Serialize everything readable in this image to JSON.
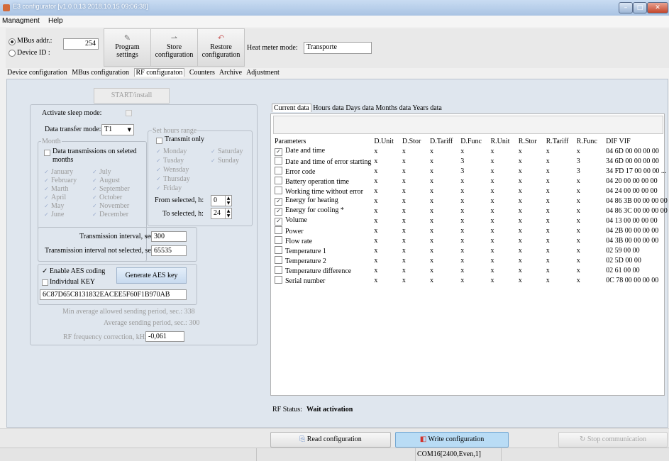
{
  "window": {
    "title": "E3 configurator [v1.0.0.13  2018.10.15 09:06:38]"
  },
  "menu": [
    "Managment",
    "Help"
  ],
  "toolbar": {
    "mbus_label": "MBus addr.:",
    "mbus_value": "254",
    "device_label": "Device ID :",
    "buttons": [
      {
        "label1": "Program",
        "label2": "settings",
        "icon": "wrench-icon"
      },
      {
        "label1": "Store",
        "label2": "configuration",
        "icon": "store-icon"
      },
      {
        "label1": "Restore",
        "label2": "configuration",
        "icon": "restore-icon"
      }
    ],
    "heat_meter_label": "Heat meter mode:",
    "heat_meter_value": "Transporte"
  },
  "tabs": [
    "Device configuration",
    "MBus configuration",
    "RF configuraton",
    "Counters",
    "Archive",
    "Adjustment"
  ],
  "active_tab": "RF configuraton",
  "rf": {
    "start_button": "START/install",
    "sleep_label": "Activate sleep mode:",
    "transfer_label": "Data transfer mode:",
    "transfer_value": "T1",
    "month_group": "Month",
    "month_check": "Data transmissions on seleted",
    "month_check2": "months",
    "months_left": [
      "January",
      "February",
      "Marth",
      "April",
      "May",
      "June"
    ],
    "months_right": [
      "July",
      "August",
      "September",
      "October",
      "November",
      "December"
    ],
    "hours_group": "Set hours range",
    "transmit_only": "Transmit only",
    "days_left": [
      "Monday",
      "Tusday",
      "Wensday",
      "Thursday",
      "Friday"
    ],
    "days_right": [
      "Saturday",
      "Sunday"
    ],
    "from_label": "From selected, h:",
    "from_value": "0",
    "to_label": "To selected, h:",
    "to_value": "24",
    "interval_label": "Transmission interval, sec.:",
    "interval_value": "300",
    "interval_ns_label": "Transmission interval not selected, sec.:",
    "interval_ns_value": "65535",
    "aes_enable": "Enable AES coding",
    "aes_individual": "Individual KEY",
    "aes_button": "Generate AES key",
    "aes_key": "6C87D65C8131832EACEE5F60F1B970AB",
    "min_period": "Min average allowed sending period, sec.: 338",
    "avg_period": "Average sending period, sec.: 300",
    "freq_label": "RF frequency correction, kHz:",
    "freq_value": "-0,061"
  },
  "data_tabs": [
    "Current data",
    "Hours data",
    "Days data",
    "Months data",
    "Years data"
  ],
  "grid": {
    "headers": [
      "Parameters",
      "D.Unit",
      "D.Stor",
      "D.Tariff",
      "D.Func",
      "R.Unit",
      "R.Stor",
      "R.Tariff",
      "R.Func",
      "DIF VIF"
    ],
    "rows": [
      {
        "checked": true,
        "name": "Date and time",
        "cells": [
          "x",
          "x",
          "x",
          "x",
          "x",
          "x",
          "x",
          "x"
        ],
        "dif": "04 6D 00 00 00 00"
      },
      {
        "checked": false,
        "name": "Date and time of error starting",
        "cells": [
          "x",
          "x",
          "x",
          "3",
          "x",
          "x",
          "x",
          "3"
        ],
        "dif": "34 6D 00 00 00 00"
      },
      {
        "checked": false,
        "name": "Error code",
        "cells": [
          "x",
          "x",
          "x",
          "3",
          "x",
          "x",
          "x",
          "3"
        ],
        "dif": "34 FD 17 00 00 00 ..."
      },
      {
        "checked": false,
        "name": "Battery operation time",
        "cells": [
          "x",
          "x",
          "x",
          "x",
          "x",
          "x",
          "x",
          "x"
        ],
        "dif": "04 20 00 00 00 00"
      },
      {
        "checked": false,
        "name": "Working time without error",
        "cells": [
          "x",
          "x",
          "x",
          "x",
          "x",
          "x",
          "x",
          "x"
        ],
        "dif": "04 24 00 00 00 00"
      },
      {
        "checked": true,
        "name": "Energy for heating",
        "cells": [
          "x",
          "x",
          "x",
          "x",
          "x",
          "x",
          "x",
          "x"
        ],
        "dif": "04 86 3B 00 00 00 00"
      },
      {
        "checked": true,
        "name": "Energy for cooling *",
        "cells": [
          "x",
          "x",
          "x",
          "x",
          "x",
          "x",
          "x",
          "x"
        ],
        "dif": "04 86 3C 00 00 00 00"
      },
      {
        "checked": true,
        "name": "Volume",
        "cells": [
          "x",
          "x",
          "x",
          "x",
          "x",
          "x",
          "x",
          "x"
        ],
        "dif": "04 13 00 00 00 00"
      },
      {
        "checked": false,
        "name": "Power",
        "cells": [
          "x",
          "x",
          "x",
          "x",
          "x",
          "x",
          "x",
          "x"
        ],
        "dif": "04 2B 00 00 00 00"
      },
      {
        "checked": false,
        "name": "Flow rate",
        "cells": [
          "x",
          "x",
          "x",
          "x",
          "x",
          "x",
          "x",
          "x"
        ],
        "dif": "04 3B 00 00 00 00"
      },
      {
        "checked": false,
        "name": "Temperature 1",
        "cells": [
          "x",
          "x",
          "x",
          "x",
          "x",
          "x",
          "x",
          "x"
        ],
        "dif": "02 59 00 00"
      },
      {
        "checked": false,
        "name": "Temperature 2",
        "cells": [
          "x",
          "x",
          "x",
          "x",
          "x",
          "x",
          "x",
          "x"
        ],
        "dif": "02 5D 00 00"
      },
      {
        "checked": false,
        "name": "Temperature difference",
        "cells": [
          "x",
          "x",
          "x",
          "x",
          "x",
          "x",
          "x",
          "x"
        ],
        "dif": "02 61 00 00"
      },
      {
        "checked": false,
        "name": "Serial number",
        "cells": [
          "x",
          "x",
          "x",
          "x",
          "x",
          "x",
          "x",
          "x"
        ],
        "dif": "0C 78 00 00 00 00"
      }
    ]
  },
  "rf_status": {
    "label": "RF Status:",
    "value": "Wait activation"
  },
  "actions": {
    "read": "Read configuration",
    "write": "Write configuration",
    "stop": "Stop communication"
  },
  "status": {
    "port": "COM16[2400,Even,1]"
  },
  "colors": {
    "write_button": "#b9dcf5",
    "panel_bg": "#dfe6ee"
  }
}
